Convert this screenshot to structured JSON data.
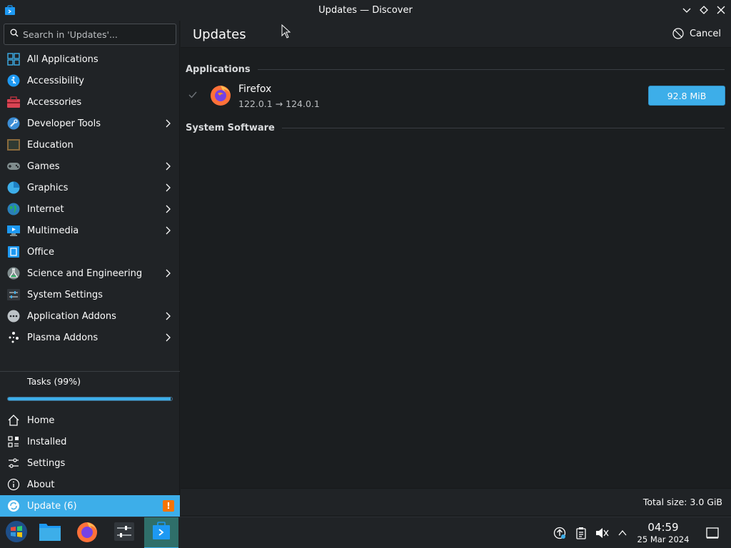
{
  "window": {
    "title": "Updates — Discover",
    "app_icon": "discover-icon"
  },
  "sidebar": {
    "search_placeholder": "Search in 'Updates'...",
    "categories": [
      {
        "label": "All Applications",
        "icon": "grid-icon",
        "submenu": false
      },
      {
        "label": "Accessibility",
        "icon": "accessibility-icon",
        "submenu": false
      },
      {
        "label": "Accessories",
        "icon": "toolbox-icon",
        "submenu": false
      },
      {
        "label": "Developer Tools",
        "icon": "wrench-icon",
        "submenu": true
      },
      {
        "label": "Education",
        "icon": "chalkboard-icon",
        "submenu": false
      },
      {
        "label": "Games",
        "icon": "gamepad-icon",
        "submenu": true
      },
      {
        "label": "Graphics",
        "icon": "graphics-icon",
        "submenu": true
      },
      {
        "label": "Internet",
        "icon": "globe-icon",
        "submenu": true
      },
      {
        "label": "Multimedia",
        "icon": "monitor-icon",
        "submenu": true
      },
      {
        "label": "Office",
        "icon": "office-icon",
        "submenu": false
      },
      {
        "label": "Science and Engineering",
        "icon": "flask-icon",
        "submenu": true
      },
      {
        "label": "System Settings",
        "icon": "settings-sliders-icon",
        "submenu": false
      },
      {
        "label": "Application Addons",
        "icon": "addons-icon",
        "submenu": true
      },
      {
        "label": "Plasma Addons",
        "icon": "plasma-icon",
        "submenu": true
      }
    ],
    "tasks_label": "Tasks (99%)",
    "tasks_progress": 0.99,
    "nav": [
      {
        "label": "Home",
        "icon": "home-icon"
      },
      {
        "label": "Installed",
        "icon": "installed-icon"
      },
      {
        "label": "Settings",
        "icon": "sliders-icon"
      },
      {
        "label": "About",
        "icon": "info-icon"
      },
      {
        "label": "Update (6)",
        "icon": "update-icon",
        "active": true,
        "badge": "!"
      }
    ]
  },
  "main": {
    "page_title": "Updates",
    "cancel_label": "Cancel",
    "sections": {
      "applications": "Applications",
      "system_software": "System Software"
    },
    "updates": [
      {
        "name": "Firefox",
        "version": "122.0.1 → 124.0.1",
        "size": "92.8 MiB",
        "icon": "firefox-icon",
        "checked": true
      }
    ],
    "total_size": "Total size: 3.0 GiB"
  },
  "taskbar": {
    "apps": [
      "start-menu-icon",
      "file-manager-icon",
      "firefox-icon",
      "system-settings-icon",
      "discover-icon"
    ],
    "tray": [
      "update-notifier-icon",
      "clipboard-icon",
      "volume-muted-icon",
      "chevron-up-icon"
    ],
    "time": "04:59",
    "date": "25 Mar 2024",
    "show_desktop_icon": "show-desktop-icon"
  },
  "colors": {
    "accent": "#3daee9",
    "background": "#1b1e20",
    "panel": "#202326",
    "warning": "#f67400"
  }
}
